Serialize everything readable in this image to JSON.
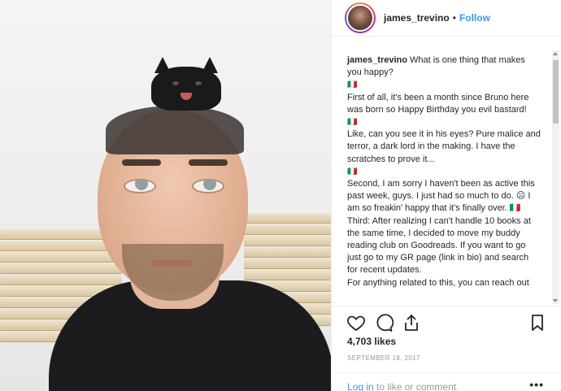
{
  "post": {
    "username": "james_trevino",
    "separator": "•",
    "follow_label": "Follow",
    "caption_username": "james_trevino",
    "caption_lines": [
      "What is one thing that makes you happy?",
      "🇮🇹",
      "First of all, it's been a month since Bruno here was born so Happy Birthday you evil bastard!",
      "🇮🇹",
      "Like, can you see it in his eyes? Pure malice and terror, a dark lord in the making. I have the scratches to prove it...",
      "🇮🇹",
      "Second, I am sorry I haven't been as active this past week, guys. I just had so much to do. ☹ I am so freakin' happy that it's finally over. 🇮🇹",
      "Third: After realizing I can't handle 10 books at the same time, I decided to move my buddy reading club on Goodreads. If you want to go just go to my GR page (link in bio) and search for recent updates.",
      "For anything related to this, you can reach out"
    ],
    "likes": "4,703 likes",
    "date": "SEPTEMBER 18, 2017",
    "login_link": "Log in",
    "login_rest": " to like or comment.",
    "more_label": "•••"
  },
  "icons": {
    "like": "heart-icon",
    "comment": "comment-icon",
    "share": "share-icon",
    "save": "bookmark-icon"
  }
}
